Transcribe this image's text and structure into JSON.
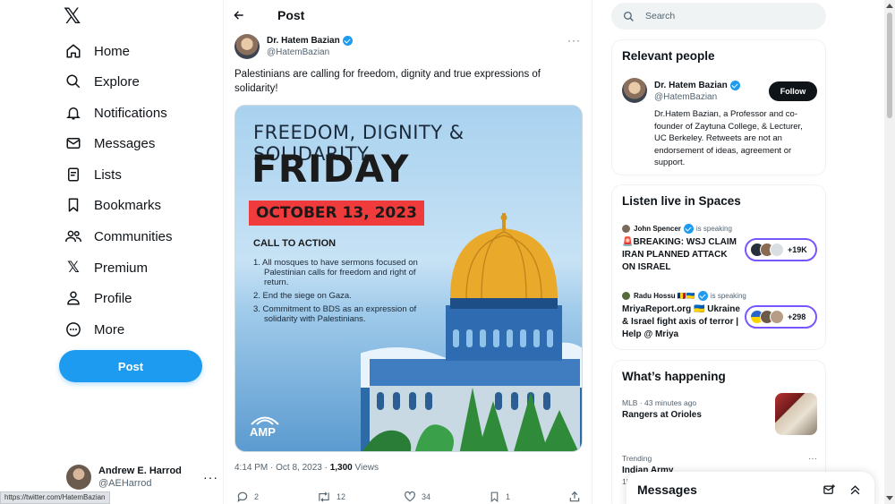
{
  "nav": {
    "logo": "𝕏",
    "items": [
      {
        "label": "Home",
        "icon": "home-icon"
      },
      {
        "label": "Explore",
        "icon": "search-icon"
      },
      {
        "label": "Notifications",
        "icon": "bell-icon"
      },
      {
        "label": "Messages",
        "icon": "envelope-icon"
      },
      {
        "label": "Lists",
        "icon": "list-icon"
      },
      {
        "label": "Bookmarks",
        "icon": "bookmark-icon"
      },
      {
        "label": "Communities",
        "icon": "people-icon"
      },
      {
        "label": "Premium",
        "icon": "x-icon"
      },
      {
        "label": "Profile",
        "icon": "person-icon"
      },
      {
        "label": "More",
        "icon": "more-circle-icon"
      }
    ],
    "post_button": "Post",
    "account": {
      "name": "Andrew E. Harrod",
      "handle": "@AEHarrod",
      "more": "···"
    }
  },
  "status_url": "https://twitter.com/HatemBazian",
  "post": {
    "header_title": "Post",
    "author_name": "Dr. Hatem Bazian",
    "author_handle": "@HatemBazian",
    "text": "Palestinians are calling for freedom, dignity and true expressions of solidarity!",
    "poster": {
      "title1": "FREEDOM, DIGNITY & SOLIDARITY",
      "title2": "FRIDAY",
      "date": "OCTOBER 13, 2023",
      "cta": "CALL TO ACTION",
      "items": [
        "1. All mosques to have sermons focused on Palestinian calls for freedom and right of return.",
        "2. End the siege on Gaza.",
        "3. Commitment to BDS as an expression of solidarity with Palestinians."
      ],
      "logo": "AMP"
    },
    "time": "4:14 PM · Oct 8, 2023 · ",
    "views_count": "1,300",
    "views_label": " Views",
    "actions": {
      "replies": "2",
      "reposts": "12",
      "likes": "34",
      "bookmarks": "1"
    }
  },
  "search": {
    "placeholder": "Search"
  },
  "relevant": {
    "title": "Relevant people",
    "name": "Dr. Hatem Bazian",
    "handle": "@HatemBazian",
    "follow": "Follow",
    "bio": "Dr.Hatem Bazian, a Professor and co-founder of Zaytuna College, & Lecturer, UC Berkeley. Retweets are not an endorsement of ideas, agreement or support."
  },
  "spaces": {
    "title": "Listen live in Spaces",
    "items": [
      {
        "host": "John Spencer",
        "speaking": "is speaking",
        "title": "🚨BREAKING: WSJ CLAIM IRAN PLANNED ATTACK ON ISRAEL",
        "count": "+19K"
      },
      {
        "host": "Radu Hossu 🇷🇴🇺🇦",
        "speaking": "is speaking",
        "title": "MriyaReport.org 🇺🇦 Ukraine & Israel fight axis of terror | Help @ Mriya",
        "count": "+298"
      }
    ]
  },
  "happening": {
    "title": "What’s happening",
    "items": [
      {
        "meta": "MLB · 43 minutes ago",
        "headline": "Rangers at Orioles"
      },
      {
        "meta": "Trending",
        "headline": "Indian Army",
        "more": "···"
      }
    ],
    "partial": "15"
  },
  "messages_drawer": {
    "title": "Messages"
  },
  "colors": {
    "accent": "#1d9bf0",
    "spaces_border": "#7856ff",
    "text": "#0f1419",
    "muted": "#536471"
  }
}
